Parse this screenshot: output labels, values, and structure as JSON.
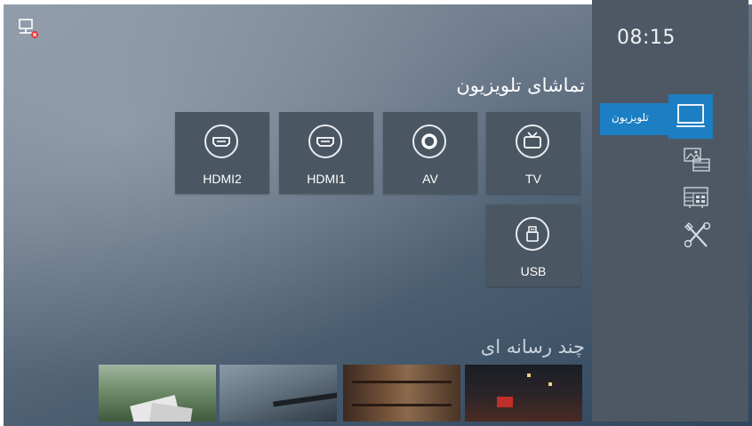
{
  "status": {
    "clock": "08:15",
    "network_icon": "network-disconnected-icon"
  },
  "tv_section": {
    "title": "تماشای تلویزیون"
  },
  "sources": [
    {
      "label": "TV",
      "icon": "tv-icon"
    },
    {
      "label": "AV",
      "icon": "av-icon"
    },
    {
      "label": "HDMI1",
      "icon": "hdmi-icon"
    },
    {
      "label": "HDMI2",
      "icon": "hdmi-icon"
    },
    {
      "label": "USB",
      "icon": "usb-icon"
    }
  ],
  "sidebar": {
    "items": [
      {
        "label": "تلویزیون",
        "icon": "tv-icon",
        "active": true
      },
      {
        "label": "",
        "icon": "media-icon",
        "active": false
      },
      {
        "label": "",
        "icon": "apps-icon",
        "active": false
      },
      {
        "label": "",
        "icon": "settings-tools-icon",
        "active": false
      }
    ]
  },
  "media_section": {
    "title": "چند رسانه ای",
    "thumbnails": [
      "photos-thumbnail",
      "desk-thumbnail",
      "bookshelf-thumbnail",
      "street-night-thumbnail"
    ]
  },
  "colors": {
    "accent": "#1c7fc3",
    "sidebar": "#4d5864",
    "tile": "#4a5661"
  }
}
